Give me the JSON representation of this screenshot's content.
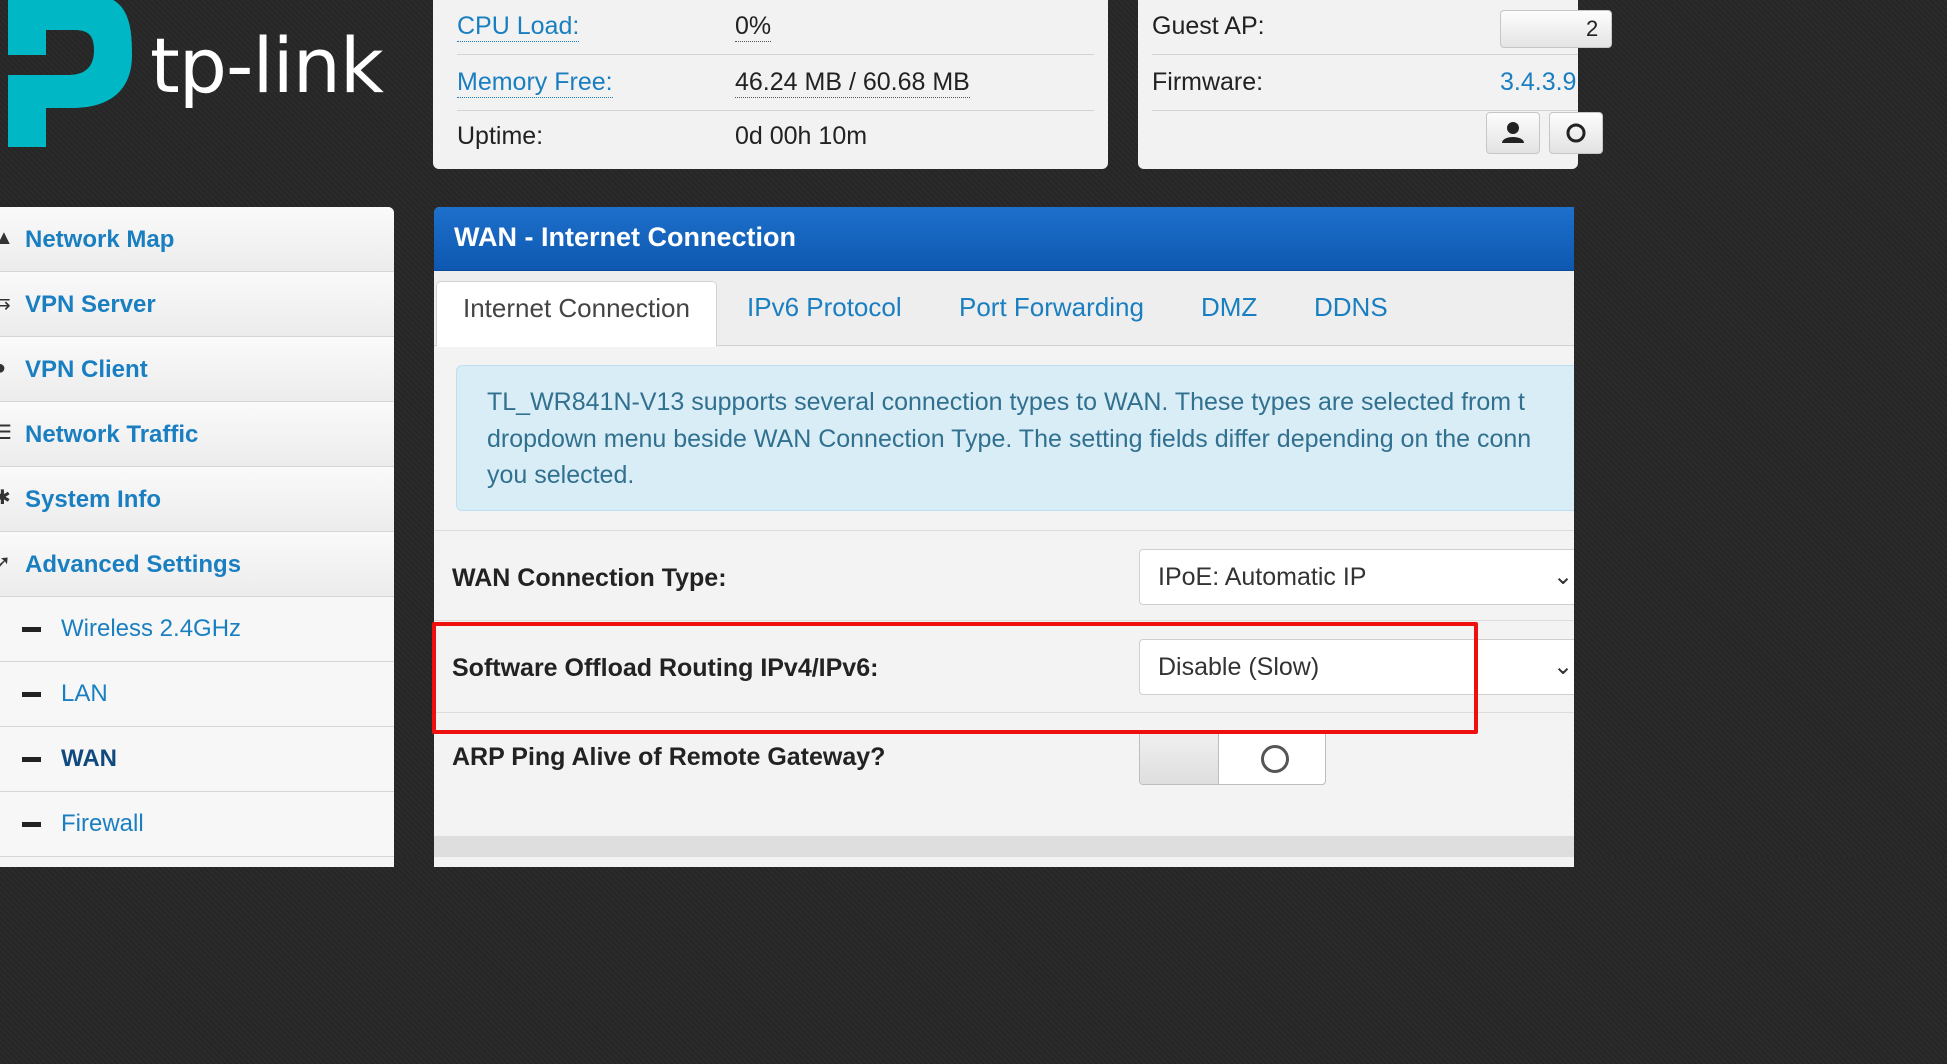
{
  "brand": {
    "logo_text": "tp-link"
  },
  "status_left": {
    "cpu_label": "CPU Load:",
    "cpu_value": "0%",
    "mem_label": "Memory Free:",
    "mem_value": "46.24 MB / 60.68 MB",
    "uptime_label": "Uptime:",
    "uptime_value": "0d 00h 10m"
  },
  "status_right": {
    "guest_label": "Guest AP:",
    "guest_value": "2",
    "firmware_label": "Firmware:",
    "firmware_value": "3.4.3.9"
  },
  "sidebar": {
    "items": [
      {
        "label": "Network Map",
        "icon": "home-icon"
      },
      {
        "label": "VPN Server",
        "icon": "vpn-server-icon"
      },
      {
        "label": "VPN Client",
        "icon": "globe-icon"
      },
      {
        "label": "Network Traffic",
        "icon": "traffic-icon"
      },
      {
        "label": "System Info",
        "icon": "gear-icon"
      },
      {
        "label": "Advanced Settings",
        "icon": "wrench-icon"
      }
    ],
    "subitems": [
      {
        "label": "Wireless 2.4GHz"
      },
      {
        "label": "LAN"
      },
      {
        "label": "WAN"
      },
      {
        "label": "Firewall"
      }
    ],
    "active_subitem": "WAN"
  },
  "panel": {
    "title": "WAN - Internet Connection",
    "tabs": [
      "Internet Connection",
      "IPv6 Protocol",
      "Port Forwarding",
      "DMZ",
      "DDNS"
    ],
    "active_tab": "Internet Connection",
    "info_text": "TL_WR841N-V13 supports several connection types to WAN. These types are selected from t\ndropdown menu beside WAN Connection Type. The setting fields differ depending on the conn\nyou selected.",
    "fields": {
      "wan_type_label": "WAN Connection Type:",
      "wan_type_value": "IPoE: Automatic IP",
      "offload_label": "Software Offload Routing IPv4/IPv6:",
      "offload_value": "Disable (Slow)",
      "arp_label": "ARP Ping Alive of Remote Gateway?",
      "arp_enabled": false
    }
  },
  "colors": {
    "accent": "#1a7fc1",
    "header": "#1466c0",
    "highlight": "#ee0f0f",
    "info_bg": "#d9edf7"
  }
}
